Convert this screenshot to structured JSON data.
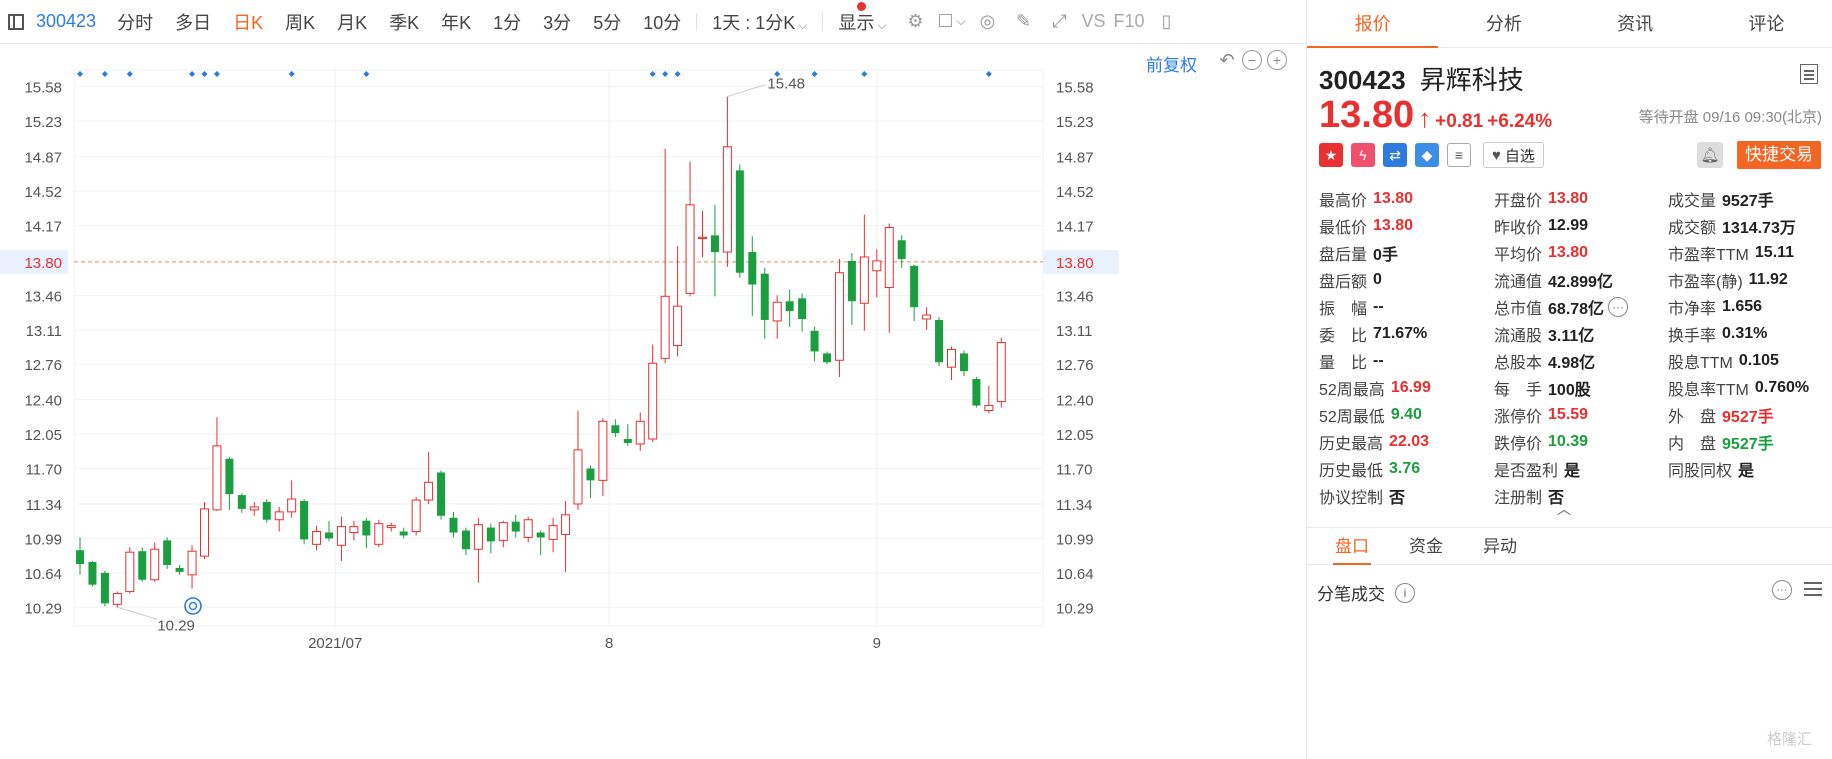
{
  "toolbar": {
    "code": "300423",
    "tabs": [
      "分时",
      "多日",
      "日K",
      "周K",
      "月K",
      "季K",
      "年K",
      "1分",
      "3分",
      "5分",
      "10分"
    ],
    "active_tab": "日K",
    "period": "1天 : 1分K",
    "display": "显示",
    "vs": "VS",
    "f10": "F10"
  },
  "chart": {
    "adjust": "前复权",
    "y_labels": [
      "15.58",
      "15.23",
      "14.87",
      "14.52",
      "14.17",
      "13.80",
      "13.46",
      "13.11",
      "12.76",
      "12.40",
      "12.05",
      "11.70",
      "11.34",
      "10.99",
      "10.64",
      "10.29"
    ],
    "current_price": "13.80",
    "max_label": "15.48",
    "min_label": "10.29",
    "x_labels": [
      "2021/07",
      "8",
      "9"
    ]
  },
  "chart_data": {
    "type": "candlestick",
    "ylim": [
      10.1,
      15.75
    ],
    "current_price": 13.8,
    "x_labels": [
      {
        "label": "2021/07",
        "index": 20.5
      },
      {
        "label": "8",
        "index": 42.5
      },
      {
        "label": "9",
        "index": 64
      }
    ],
    "markers_at": [
      0,
      2,
      4,
      9,
      10,
      11,
      17,
      23,
      46,
      47,
      48,
      56,
      59,
      63,
      73
    ],
    "candles": [
      [
        10.87,
        10.73,
        11.0,
        10.62
      ],
      [
        10.75,
        10.52,
        10.76,
        10.5
      ],
      [
        10.64,
        10.33,
        10.66,
        10.3
      ],
      [
        10.32,
        10.43,
        10.45,
        10.29
      ],
      [
        10.45,
        10.85,
        10.9,
        10.43
      ],
      [
        10.86,
        10.57,
        10.9,
        10.55
      ],
      [
        10.57,
        10.88,
        10.95,
        10.55
      ],
      [
        10.97,
        10.72,
        11.0,
        10.68
      ],
      [
        10.69,
        10.65,
        10.72,
        10.62
      ],
      [
        10.62,
        10.86,
        10.92,
        10.48
      ],
      [
        10.81,
        11.29,
        11.36,
        10.78
      ],
      [
        11.28,
        11.93,
        12.22,
        11.27
      ],
      [
        11.8,
        11.44,
        11.82,
        11.28
      ],
      [
        11.43,
        11.29,
        11.45,
        11.25
      ],
      [
        11.28,
        11.31,
        11.36,
        11.22
      ],
      [
        11.36,
        11.18,
        11.39,
        11.15
      ],
      [
        11.18,
        11.26,
        11.31,
        11.06
      ],
      [
        11.26,
        11.39,
        11.58,
        11.2
      ],
      [
        11.37,
        10.98,
        11.39,
        10.93
      ],
      [
        10.93,
        11.06,
        11.12,
        10.87
      ],
      [
        11.05,
        10.99,
        11.17,
        10.96
      ],
      [
        10.92,
        11.11,
        11.21,
        10.76
      ],
      [
        11.05,
        11.11,
        11.17,
        10.97
      ],
      [
        11.17,
        11.02,
        11.2,
        10.89
      ],
      [
        10.93,
        11.14,
        11.18,
        10.9
      ],
      [
        11.1,
        11.12,
        11.15,
        11.06
      ],
      [
        11.06,
        11.02,
        11.1,
        10.99
      ],
      [
        11.06,
        11.38,
        11.41,
        11.02
      ],
      [
        11.38,
        11.56,
        11.87,
        11.34
      ],
      [
        11.66,
        11.22,
        11.68,
        11.18
      ],
      [
        11.2,
        11.05,
        11.26,
        11.0
      ],
      [
        11.07,
        10.88,
        11.1,
        10.82
      ],
      [
        10.88,
        11.13,
        11.2,
        10.54
      ],
      [
        11.1,
        10.96,
        11.14,
        10.84
      ],
      [
        10.97,
        11.15,
        11.17,
        10.9
      ],
      [
        11.16,
        11.06,
        11.23,
        11.0
      ],
      [
        11.0,
        11.18,
        11.21,
        10.95
      ],
      [
        11.05,
        11.0,
        11.07,
        10.82
      ],
      [
        10.98,
        11.12,
        11.2,
        10.85
      ],
      [
        11.03,
        11.23,
        11.37,
        10.65
      ],
      [
        11.34,
        11.89,
        12.29,
        11.28
      ],
      [
        11.7,
        11.58,
        11.73,
        11.4
      ],
      [
        11.58,
        12.18,
        12.21,
        11.42
      ],
      [
        12.14,
        12.06,
        12.2,
        12.02
      ],
      [
        12.0,
        11.96,
        12.15,
        11.93
      ],
      [
        11.95,
        12.18,
        12.27,
        11.88
      ],
      [
        12.0,
        12.77,
        12.96,
        11.97
      ],
      [
        12.82,
        13.45,
        14.95,
        12.77
      ],
      [
        12.95,
        13.35,
        13.96,
        12.84
      ],
      [
        13.48,
        14.38,
        14.82,
        13.45
      ],
      [
        14.05,
        14.05,
        14.32,
        13.85
      ],
      [
        14.07,
        13.9,
        14.38,
        13.45
      ],
      [
        13.9,
        14.97,
        15.48,
        13.75
      ],
      [
        14.73,
        13.69,
        14.79,
        13.64
      ],
      [
        13.9,
        13.57,
        14.06,
        13.25
      ],
      [
        13.68,
        13.21,
        13.74,
        13.02
      ],
      [
        13.2,
        13.39,
        13.46,
        13.02
      ],
      [
        13.4,
        13.3,
        13.52,
        13.14
      ],
      [
        13.43,
        13.22,
        13.48,
        13.09
      ],
      [
        13.1,
        12.89,
        13.14,
        12.79
      ],
      [
        12.87,
        12.78,
        12.89,
        12.76
      ],
      [
        12.8,
        13.69,
        13.83,
        12.63
      ],
      [
        13.81,
        13.4,
        13.89,
        13.16
      ],
      [
        13.38,
        13.85,
        14.28,
        13.1
      ],
      [
        13.71,
        13.81,
        13.93,
        13.44
      ],
      [
        13.54,
        14.15,
        14.19,
        13.08
      ],
      [
        14.02,
        13.83,
        14.07,
        13.74
      ],
      [
        13.76,
        13.34,
        13.77,
        13.2
      ],
      [
        13.22,
        13.26,
        13.34,
        13.11
      ],
      [
        13.21,
        12.78,
        13.24,
        12.74
      ],
      [
        12.73,
        12.91,
        12.94,
        12.6
      ],
      [
        12.87,
        12.69,
        12.9,
        12.64
      ],
      [
        12.61,
        12.34,
        12.63,
        12.32
      ],
      [
        12.29,
        12.34,
        12.54,
        12.26
      ],
      [
        12.38,
        12.98,
        13.03,
        12.32
      ]
    ]
  },
  "tabs": [
    "报价",
    "分析",
    "资讯",
    "评论"
  ],
  "stock": {
    "code": "300423",
    "name": "昇辉科技",
    "price": "13.80",
    "arrow": "↑",
    "change": "+0.81",
    "change_pct": "+6.24%",
    "status": "等待开盘 09/16 09:30(北京)",
    "watch_label": "自选",
    "quick_trade": "快捷交易"
  },
  "stats": [
    [
      {
        "l": "最高价",
        "v": "13.80",
        "c": "red"
      },
      {
        "l": "开盘价",
        "v": "13.80",
        "c": "red"
      },
      {
        "l": "成交量",
        "v": "9527手",
        "c": ""
      }
    ],
    [
      {
        "l": "最低价",
        "v": "13.80",
        "c": "red"
      },
      {
        "l": "昨收价",
        "v": "12.99",
        "c": ""
      },
      {
        "l": "成交额",
        "v": "1314.73万",
        "c": ""
      }
    ],
    [
      {
        "l": "盘后量",
        "v": "0手",
        "c": ""
      },
      {
        "l": "平均价",
        "v": "13.80",
        "c": "red"
      },
      {
        "l": "市盈率TTM",
        "v": "15.11",
        "c": ""
      }
    ],
    [
      {
        "l": "盘后额",
        "v": "0",
        "c": ""
      },
      {
        "l": "流通值",
        "v": "42.899亿",
        "c": ""
      },
      {
        "l": "市盈率(静)",
        "v": "11.92",
        "c": ""
      }
    ],
    [
      {
        "l": "振　幅",
        "v": "--",
        "c": ""
      },
      {
        "l": "总市值",
        "v": "68.78亿",
        "c": ""
      },
      {
        "l": "市净率",
        "v": "1.656",
        "c": ""
      }
    ],
    [
      {
        "l": "委　比",
        "v": "71.67%",
        "c": ""
      },
      {
        "l": "流通股",
        "v": "3.11亿",
        "c": ""
      },
      {
        "l": "换手率",
        "v": "0.31%",
        "c": ""
      }
    ],
    [
      {
        "l": "量　比",
        "v": "--",
        "c": ""
      },
      {
        "l": "总股本",
        "v": "4.98亿",
        "c": ""
      },
      {
        "l": "股息TTM",
        "v": "0.105",
        "c": ""
      }
    ],
    [
      {
        "l": "52周最高",
        "v": "16.99",
        "c": "red"
      },
      {
        "l": "每　手",
        "v": "100股",
        "c": ""
      },
      {
        "l": "股息率TTM",
        "v": "0.760%",
        "c": ""
      }
    ],
    [
      {
        "l": "52周最低",
        "v": "9.40",
        "c": "green"
      },
      {
        "l": "涨停价",
        "v": "15.59",
        "c": "red"
      },
      {
        "l": "外　盘",
        "v": "9527手",
        "c": "red"
      }
    ],
    [
      {
        "l": "历史最高",
        "v": "22.03",
        "c": "red"
      },
      {
        "l": "跌停价",
        "v": "10.39",
        "c": "green"
      },
      {
        "l": "内　盘",
        "v": "9527手",
        "c": "green"
      }
    ],
    [
      {
        "l": "历史最低",
        "v": "3.76",
        "c": "green"
      },
      {
        "l": "是否盈利",
        "v": "是",
        "c": ""
      },
      {
        "l": "同股同权",
        "v": "是",
        "c": ""
      }
    ],
    [
      {
        "l": "协议控制",
        "v": "否",
        "c": ""
      },
      {
        "l": "注册制",
        "v": "否",
        "c": ""
      },
      {
        "l": "",
        "v": "",
        "c": ""
      }
    ]
  ],
  "subtabs": [
    "盘口",
    "资金",
    "异动"
  ],
  "ticks_title": "分笔成交",
  "watermark": "格隆汇",
  "colors": {
    "up": "#e93030",
    "down": "#1a9e3f",
    "accent": "#f26522",
    "link": "#2d7be0"
  }
}
